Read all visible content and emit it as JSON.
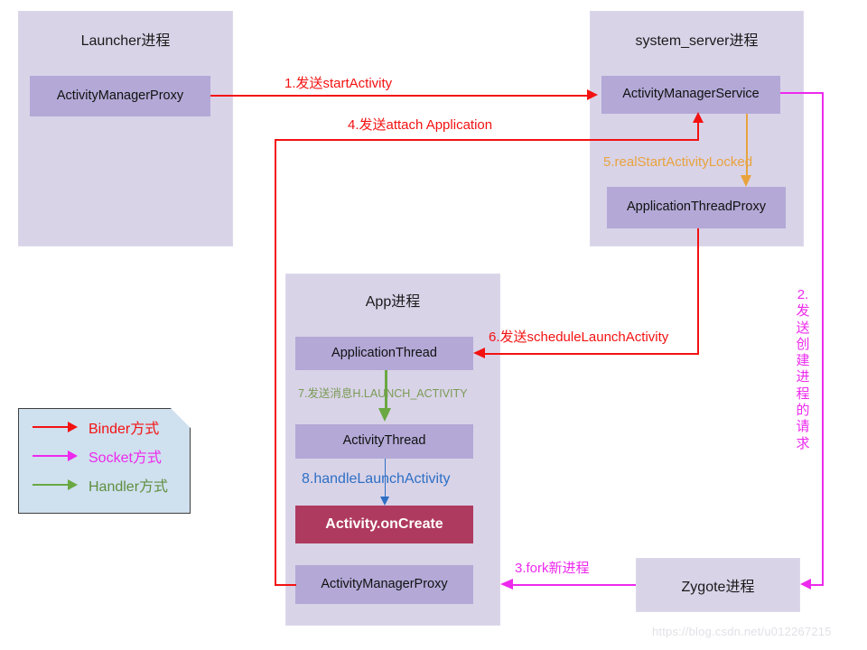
{
  "colors": {
    "binder_red": "#f31212",
    "socket_magenta": "#ed29ed",
    "handler_green": "#69a842",
    "orange": "#e8a33d",
    "blue": "#2d6fc4",
    "process_fill": "#d9d3e8",
    "component_fill": "#b3a8d6",
    "highlight_fill": "#af3a5f",
    "legend_fill": "#cfe0ef"
  },
  "processes": {
    "launcher": {
      "title": "Launcher进程",
      "components": [
        {
          "label": "ActivityManagerProxy"
        }
      ]
    },
    "system_server": {
      "title": "system_server进程",
      "components": [
        {
          "label": "ActivityManagerService"
        },
        {
          "label": "ApplicationThreadProxy"
        }
      ]
    },
    "app": {
      "title": "App进程",
      "components": [
        {
          "label": "ApplicationThread"
        },
        {
          "label": "ActivityThread"
        },
        {
          "label": "Activity.onCreate"
        },
        {
          "label": "ActivityManagerProxy"
        }
      ]
    },
    "zygote": {
      "title": "Zygote进程"
    }
  },
  "connections": {
    "step1": {
      "label": "1.发送startActivity",
      "color": "#f31212",
      "kind": "Binder"
    },
    "step2": {
      "label": "2.发送创建进程的请求",
      "color": "#ed29ed",
      "kind": "Socket"
    },
    "step3": {
      "label": "3.fork新进程",
      "color": "#ed29ed",
      "kind": "Socket"
    },
    "step4": {
      "label": "4.发送attach Application",
      "color": "#f31212",
      "kind": "Binder"
    },
    "step5": {
      "label": "5.realStartActivityLocked",
      "color": "#e8a33d",
      "kind": "Call"
    },
    "step6": {
      "label": "6.发送scheduleLaunchActivity",
      "color": "#f31212",
      "kind": "Binder"
    },
    "step7": {
      "label": "7.发送消息H.LAUNCH_ACTIVITY",
      "color": "#69a842",
      "kind": "Handler"
    },
    "step8": {
      "label": "8.handleLaunchActivity",
      "color": "#2d6fc4",
      "kind": "Call"
    }
  },
  "legend": {
    "items": [
      {
        "label": "Binder方式",
        "color": "#f31212"
      },
      {
        "label": "Socket方式",
        "color": "#ed29ed"
      },
      {
        "label": "Handler方式",
        "color": "#69a842"
      }
    ]
  },
  "watermark": {
    "text": "https://blog.csdn.net/u012267215"
  }
}
